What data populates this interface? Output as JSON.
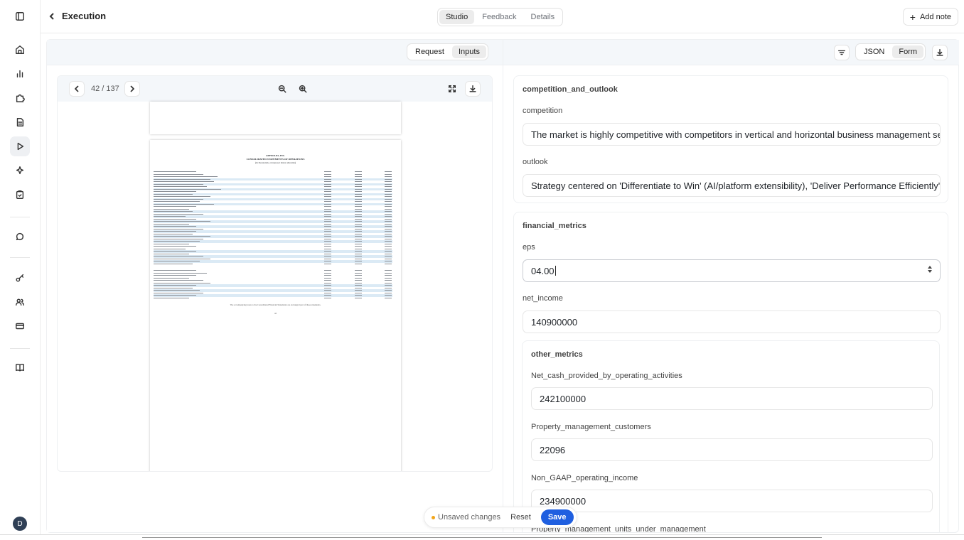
{
  "header": {
    "title": "Execution",
    "tabs": [
      {
        "label": "Studio",
        "active": true
      },
      {
        "label": "Feedback",
        "active": false
      },
      {
        "label": "Details",
        "active": false
      }
    ],
    "add_note": "Add note"
  },
  "sidebar": {
    "icons": [
      "sidebar-toggle-icon",
      "home-icon",
      "bar-chart-icon",
      "puzzle-icon",
      "document-icon",
      "play-icon",
      "sparkles-icon",
      "clipboard-check-icon",
      "chat-icon",
      "key-icon",
      "users-icon",
      "credit-card-icon",
      "book-icon"
    ],
    "avatar_initial": "D"
  },
  "left_panel": {
    "toggle": [
      {
        "label": "Request",
        "active": false
      },
      {
        "label": "Inputs",
        "active": true
      }
    ],
    "viewer": {
      "page_indicator": "42 / 137"
    },
    "document": {
      "company": "APPFOLIO, INC.",
      "statement": "CONSOLIDATED STATEMENTS OF OPERATIONS",
      "units": "(in thousands, except per share amounts)",
      "footer_note": "The accompanying notes to the Consolidated Financial Statements are an integral part of these statements.",
      "page_number": "42"
    }
  },
  "right_panel": {
    "toggle": [
      {
        "label": "JSON",
        "active": false
      },
      {
        "label": "Form",
        "active": true
      }
    ],
    "sections": {
      "competition_and_outlook": {
        "title": "competition_and_outlook",
        "competition_label": "competition",
        "competition_value": "The market is highly competitive with competitors in vertical and horizontal business management ser",
        "outlook_label": "outlook",
        "outlook_value": "Strategy centered on 'Differentiate to Win' (AI/platform extensibility), 'Deliver Performance Efficiently' (a"
      },
      "financial_metrics": {
        "title": "financial_metrics",
        "eps_label": "eps",
        "eps_value": "04.00",
        "net_income_label": "net_income",
        "net_income_value": "140900000",
        "other_metrics": {
          "title": "other_metrics",
          "ncp_label": "Net_cash_provided_by_operating_activities",
          "ncp_value": "242100000",
          "pmc_label": "Property_management_customers",
          "pmc_value": "22096",
          "ngoi_label": "Non_GAAP_operating_income",
          "ngoi_value": "234900000",
          "pmu_label": "Property_management_units_under_management"
        }
      }
    }
  },
  "savebar": {
    "unsaved": "Unsaved changes",
    "reset": "Reset",
    "save": "Save"
  }
}
